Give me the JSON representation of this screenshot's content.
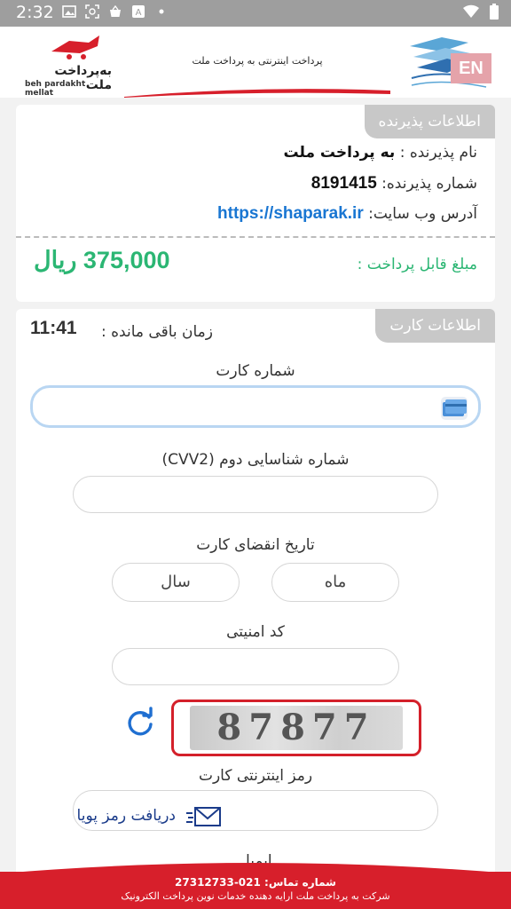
{
  "status_bar": {
    "time": "2:32"
  },
  "header": {
    "title": "پرداخت اینترنتی به پرداخت ملت",
    "logo_fa": "به‌پرداخت ملت",
    "logo_en": "beh pardakht mellat",
    "lang_button": "EN"
  },
  "merchant": {
    "tab": "اطلاعات پذیرنده",
    "name_label": "نام پذیرنده :",
    "name_value": "به پرداخت ملت",
    "number_label": "شماره پذیرنده:",
    "number_value": "8191415",
    "site_label": "آدرس وب سایت:",
    "site_value": "https://shaparak.ir",
    "amount_label": "مبلغ قابل پرداخت :",
    "amount_value": "375,000 ریال"
  },
  "card": {
    "tab": "اطلاعات کارت",
    "timer_label": "زمان باقی مانده :",
    "timer_value": "11:41",
    "card_number_label": "شماره کارت",
    "cvv2_label": "شماره شناسایی دوم (CVV2)",
    "expiry_label": "تاریخ انقضای کارت",
    "month_placeholder": "ماه",
    "year_placeholder": "سال",
    "captcha_label": "کد امنیتی",
    "captcha_text": "87877",
    "pin_label": "رمز اینترنتی کارت",
    "dynamic_pin_button": "دریافت رمز پویا",
    "email_label": "ایمیل"
  },
  "footer": {
    "phone": "شماره تماس: 021-27312733",
    "company": "شرکت به پرداخت ملت ارایه دهنده خدمات نوین پرداخت الکترونیک"
  },
  "colors": {
    "accent_green": "#2bb673",
    "link_blue": "#1976d2",
    "brand_red": "#d71f2b"
  }
}
